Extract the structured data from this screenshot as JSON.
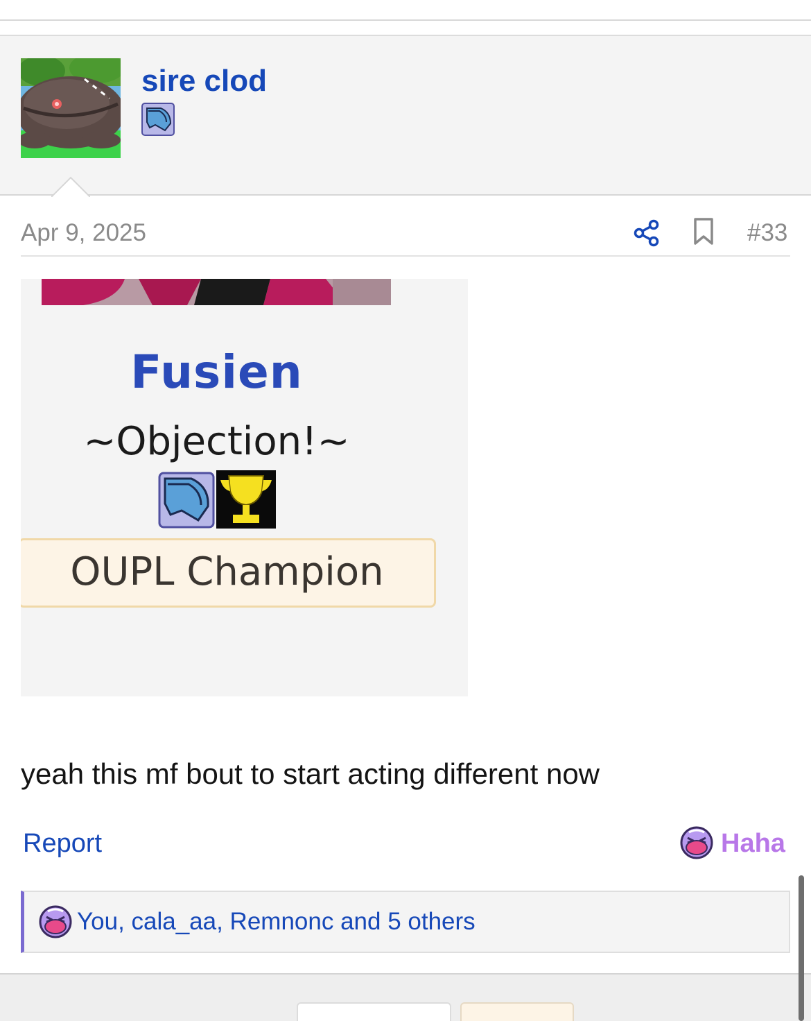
{
  "post": {
    "author": "sire clod",
    "date": "Apr 9, 2025",
    "number": "#33",
    "text": "yeah this mf bout to start acting different now"
  },
  "signature": {
    "name": "Fusien",
    "title": "~Objection!~",
    "banner": "OUPL Champion"
  },
  "actions": {
    "report": "Report",
    "reaction": "Haha"
  },
  "reactions": {
    "summary": "You, cala_aa, Remnonc and 5 others"
  },
  "icons": {
    "share": "share-icon",
    "bookmark": "bookmark-icon",
    "reaction": "haha-face-icon"
  },
  "colors": {
    "link": "#1648b8",
    "reaction": "#b877e8",
    "reactions_accent": "#7a6ad0"
  }
}
